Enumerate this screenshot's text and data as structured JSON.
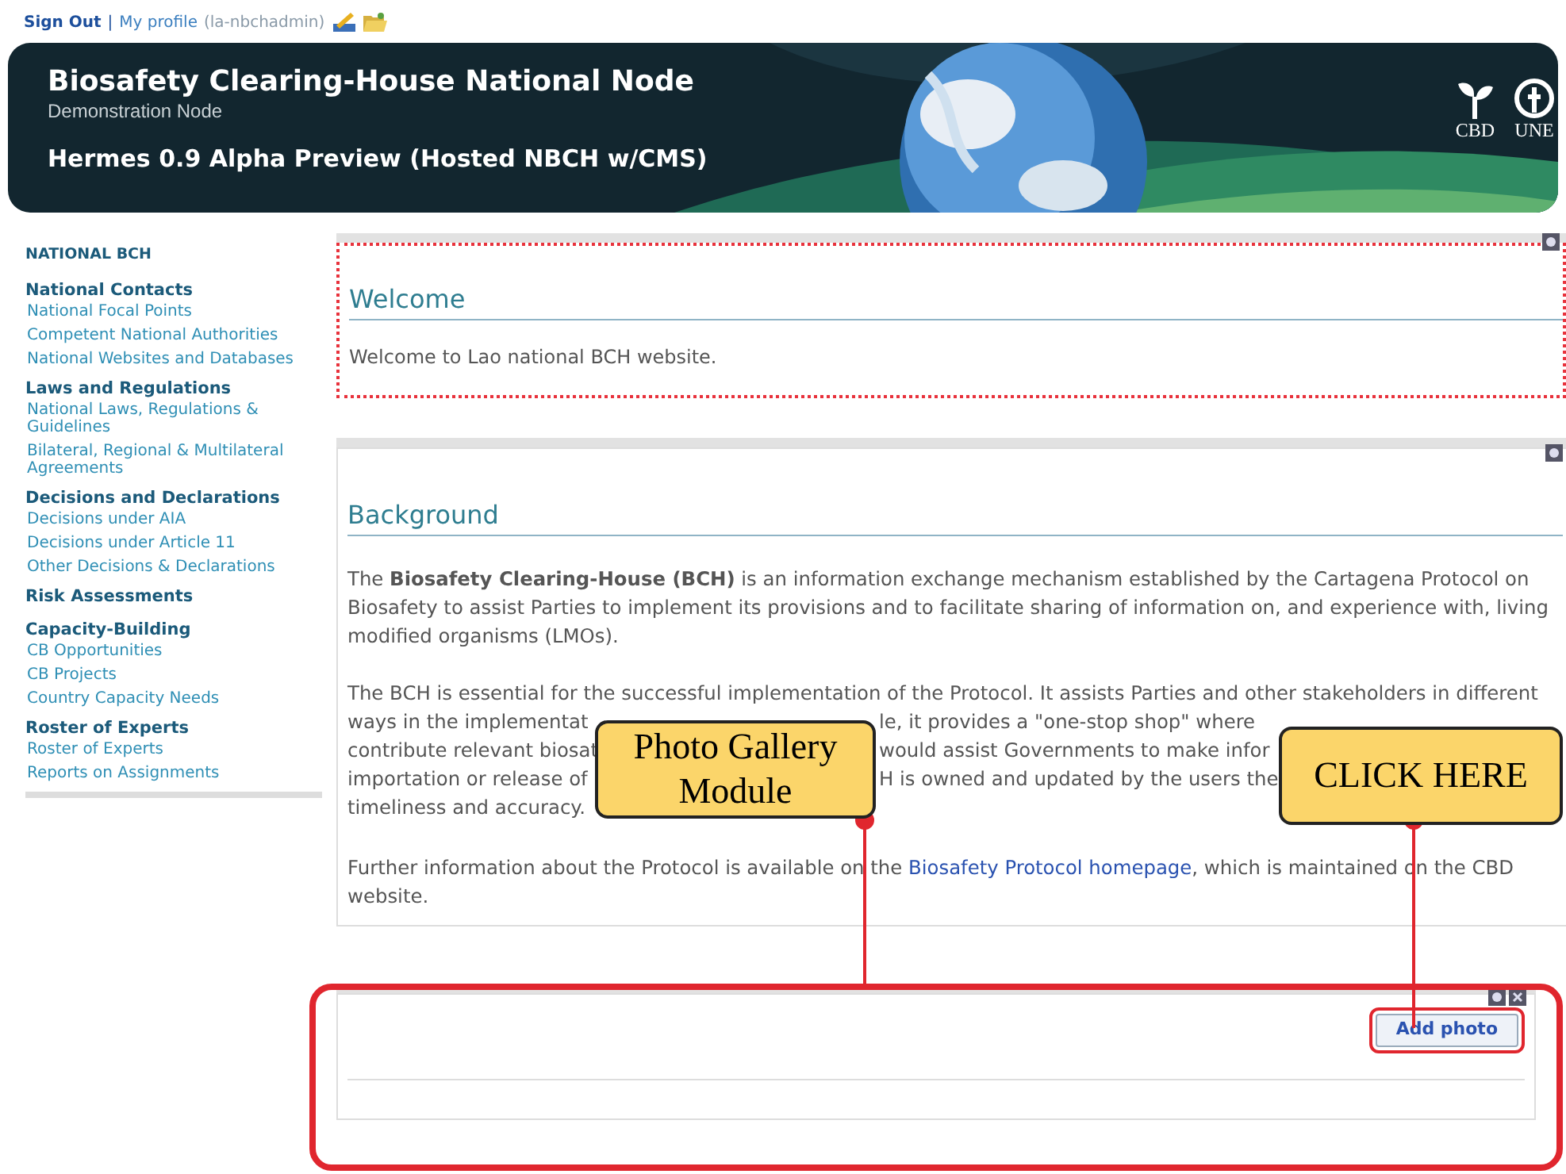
{
  "top_bar": {
    "sign_out": "Sign Out",
    "separator": "|",
    "my_profile": "My profile",
    "username": "(la-nbchadmin)"
  },
  "header": {
    "title": "Biosafety Clearing-House National Node",
    "subtitle": "Demonstration Node",
    "version": "Hermes 0.9 Alpha Preview (Hosted NBCH w/CMS)",
    "logos": [
      {
        "label": "CBD"
      },
      {
        "label": "UNE"
      }
    ]
  },
  "sidebar": {
    "heading": "NATIONAL BCH",
    "sections": [
      {
        "title": "National Contacts",
        "items": [
          "National Focal Points",
          "Competent National Authorities",
          "National Websites and Databases"
        ]
      },
      {
        "title": "Laws and Regulations",
        "items": [
          "National Laws, Regulations & Guidelines",
          "Bilateral, Regional & Multilateral Agreements"
        ]
      },
      {
        "title": "Decisions and Declarations",
        "items": [
          "Decisions under AIA",
          "Decisions under Article 11",
          "Other Decisions & Declarations"
        ]
      },
      {
        "title": "Risk Assessments"
      },
      {
        "title": "Capacity-Building",
        "items": [
          "CB Opportunities",
          "CB Projects",
          "Country Capacity Needs"
        ]
      },
      {
        "title": "Roster of Experts",
        "items": [
          "Roster of Experts",
          "Reports on Assignments"
        ]
      }
    ]
  },
  "welcome": {
    "title": "Welcome",
    "text": "Welcome to Lao national BCH website."
  },
  "background": {
    "title": "Background",
    "paragraph_1": "The **Biosafety Clearing-House (BCH)** is an information exchange mechanism established by the Cartagena Protocol on Biosafety to assist Parties to implement its provisions and to facilitate sharing of information on, and experience with, living modified organisms (LMOs).",
    "paragraph_2_first": "The BCH is essential for the successful implementation of the Protocol. It assists Parties and other stakeholders in different",
    "paragraph_2_lines": [
      [
        "ways in the implementat",
        "le, it provides a \"one-stop shop\" where"
      ],
      [
        "contribute relevant biosat",
        "would assist Governments to make infor"
      ],
      [
        "importation or release of",
        "H is owned and updated by the users the"
      ]
    ],
    "paragraph_2_last": "timeliness and accuracy.",
    "paragraph_3": {
      "before": "Further information about the Protocol is available on the ",
      "link": "Biosafety Protocol homepage",
      "after": ", which is maintained on the CBD website."
    }
  },
  "photo_gallery": {
    "button": "Add photo"
  },
  "callouts": [
    {
      "text": "Photo Gallery Module"
    },
    {
      "text": "CLICK HERE"
    }
  ]
}
